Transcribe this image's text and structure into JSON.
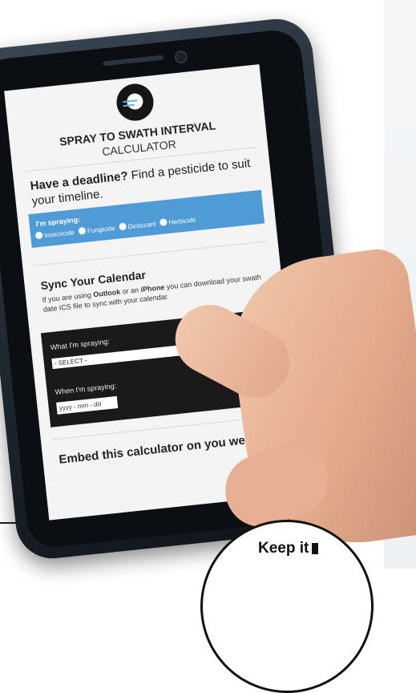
{
  "calculator": {
    "title_bold": "SPRAY TO SWATH INTERVAL",
    "title_rest": "CALCULATOR",
    "deadline_bold": "Have a deadline?",
    "deadline_rest": " Find a pesticide to suit your timeline.",
    "spraying_label": "I'm spraying:",
    "options": [
      "Insecticide",
      "Fungicide",
      "Desiccant",
      "Herbicide"
    ],
    "sync_title": "Sync Your Calendar",
    "sync_text_1": "If you are using ",
    "sync_outlook": "Outlook",
    "sync_text_2": " or an ",
    "sync_iphone": "iPhone",
    "sync_text_3": " you can download your swath date ICS file to sync with your calendar.",
    "what_label": "What I'm spraying:",
    "select_value": "- SELECT -",
    "when_label": "When I'm spraying:",
    "date_placeholder": "yyyy - mm - dd",
    "embed_title": "Embed this calculator on you website"
  },
  "badge": {
    "text": "Keep it"
  },
  "colors": {
    "blue_panel": "#4f9bd6",
    "dark_panel": "#1a1a1a"
  }
}
